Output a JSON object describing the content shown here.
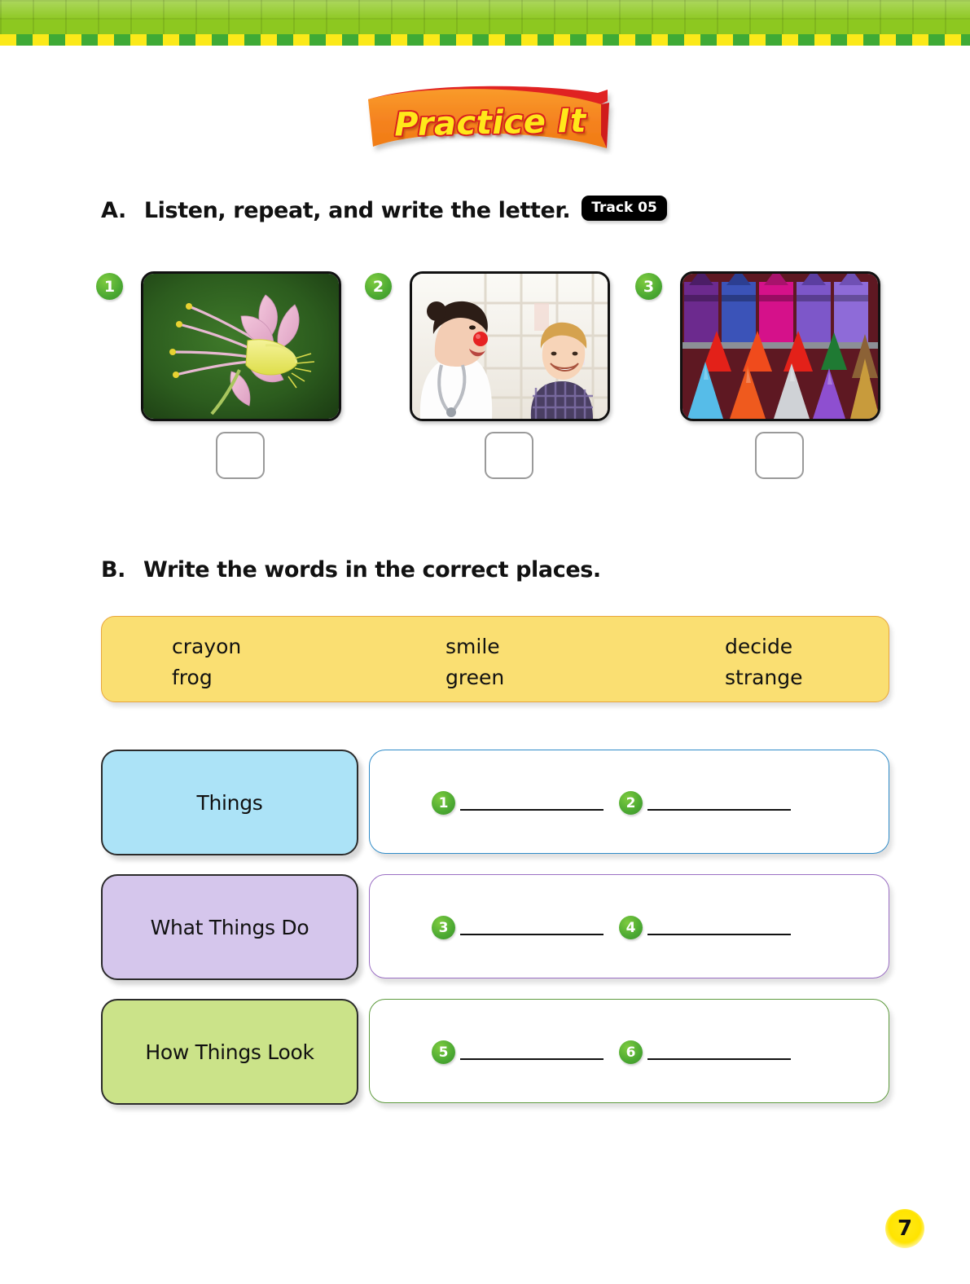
{
  "page": {
    "number": "7",
    "banner_title": "Practice It"
  },
  "colors": {
    "header_green": "#8dc820",
    "check_yellow": "#fbe919",
    "check_green": "#3faa35",
    "ribbon_orange": "#f58220",
    "ribbon_red": "#e02020",
    "ribbon_text": "#ffe81a",
    "wordbank_fill": "#fadf72",
    "wordbank_border": "#e8a63c",
    "number_badge_green": "#4aa832",
    "page_number_yellow": "#ffe400"
  },
  "section_a": {
    "letter": "A.",
    "instruction": "Listen, repeat, and write the letter.",
    "track_badge": "Track 05",
    "items": [
      {
        "number": "1",
        "image": "flower-photo",
        "description": "pink and yellow columbine flower on dark green background"
      },
      {
        "number": "2",
        "image": "nurse-child-photo",
        "description": "smiling nurse with red clown nose and laughing boy"
      },
      {
        "number": "3",
        "image": "crayons-photo",
        "description": "rows of colorful crayon tips"
      }
    ]
  },
  "section_b": {
    "letter": "B.",
    "instruction": "Write the words in the correct places.",
    "word_bank": {
      "columns": [
        [
          "crayon",
          "frog"
        ],
        [
          "smile",
          "green"
        ],
        [
          "decide",
          "strange"
        ]
      ]
    },
    "rows": [
      {
        "label": "Things",
        "label_fill": "#ace3f7",
        "box_border": "#2e8bc8",
        "answers": [
          {
            "number": "1",
            "value": ""
          },
          {
            "number": "2",
            "value": ""
          }
        ]
      },
      {
        "label": "What Things Do",
        "label_fill": "#d5c6ec",
        "box_border": "#9b6fc4",
        "answers": [
          {
            "number": "3",
            "value": ""
          },
          {
            "number": "4",
            "value": ""
          }
        ]
      },
      {
        "label": "How Things Look",
        "label_fill": "#cbe389",
        "box_border": "#5e9b3e",
        "answers": [
          {
            "number": "5",
            "value": ""
          },
          {
            "number": "6",
            "value": ""
          }
        ]
      }
    ]
  }
}
